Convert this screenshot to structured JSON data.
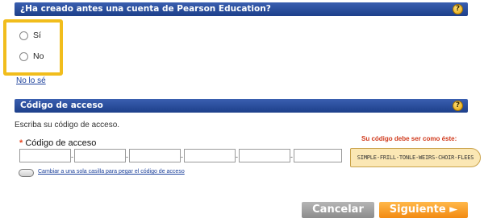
{
  "section1": {
    "title": "¿Ha creado antes una cuenta de Pearson Education?",
    "help_icon": "question-icon",
    "options": [
      {
        "label": "Sí",
        "selected": false
      },
      {
        "label": "No",
        "selected": false
      }
    ],
    "unknown_link": "No lo sé",
    "highlight_color": "#f1bd1c"
  },
  "section2": {
    "title": "Código de acceso",
    "help_icon": "question-icon",
    "instruction": "Escriba su código de acceso.",
    "required_marker": "*",
    "field_label": "Código de acceso",
    "code_boxes": [
      "",
      "",
      "",
      "",
      "",
      ""
    ],
    "single_box_link": "Cambiar a una sola casilla para pegar el código de acceso",
    "example_caption": "Su código debe ser como éste:",
    "example_code": "SIMPLE-FRILL-TONLE-WEIRS-CHOIR-FLEES"
  },
  "buttons": {
    "cancel": "Cancelar",
    "next": "Siguiente ►"
  },
  "colors": {
    "header_blue": "#1d3f8a",
    "next_orange": "#f28a12",
    "required_red": "#e8451e",
    "caption_red": "#d0391b"
  }
}
